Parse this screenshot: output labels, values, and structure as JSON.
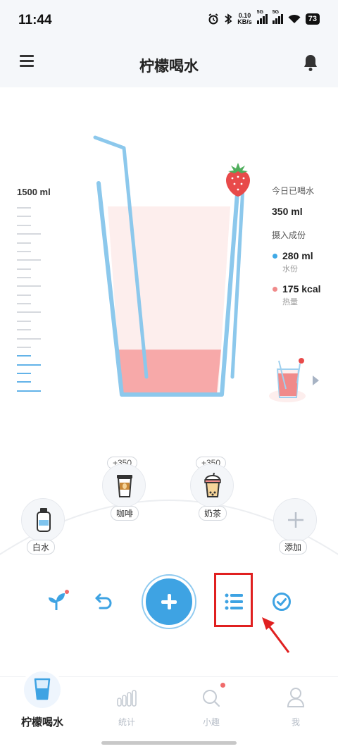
{
  "status_bar": {
    "time": "11:44",
    "net_speed_value": "0.10",
    "net_speed_unit": "KB/s",
    "signal_1_label": "5G",
    "signal_2_label": "5G",
    "battery": "73"
  },
  "header": {
    "title": "柠檬喝水"
  },
  "glass": {
    "capacity_label": "1500 ml",
    "fill_fraction": 0.23
  },
  "summary": {
    "today_label": "今日已喝水",
    "today_value": "350 ml",
    "intake_label": "摄入成份",
    "water_value": "280 ml",
    "water_label": "水份",
    "water_color": "#3fa9e6",
    "calorie_value": "175 kcal",
    "calorie_label": "热量",
    "calorie_color": "#f08a8a"
  },
  "drinks": {
    "water_label": "白水",
    "coffee_amount": "+350",
    "coffee_label": "咖啡",
    "milktea_amount": "+350",
    "milktea_label": "奶茶",
    "add_label": "添加"
  },
  "colors": {
    "accent": "#3ea3e3",
    "glass_outline": "#8cc8ec",
    "drink_fill": "#f7a9a9",
    "highlight": "#e02020"
  },
  "bottom_nav": {
    "items": [
      {
        "label": "柠檬喝水",
        "icon": "glass-icon",
        "active": true
      },
      {
        "label": "统计",
        "icon": "chart-icon",
        "active": false
      },
      {
        "label": "小趣",
        "icon": "search-icon",
        "active": false
      },
      {
        "label": "我",
        "icon": "person-icon",
        "active": false
      }
    ]
  }
}
